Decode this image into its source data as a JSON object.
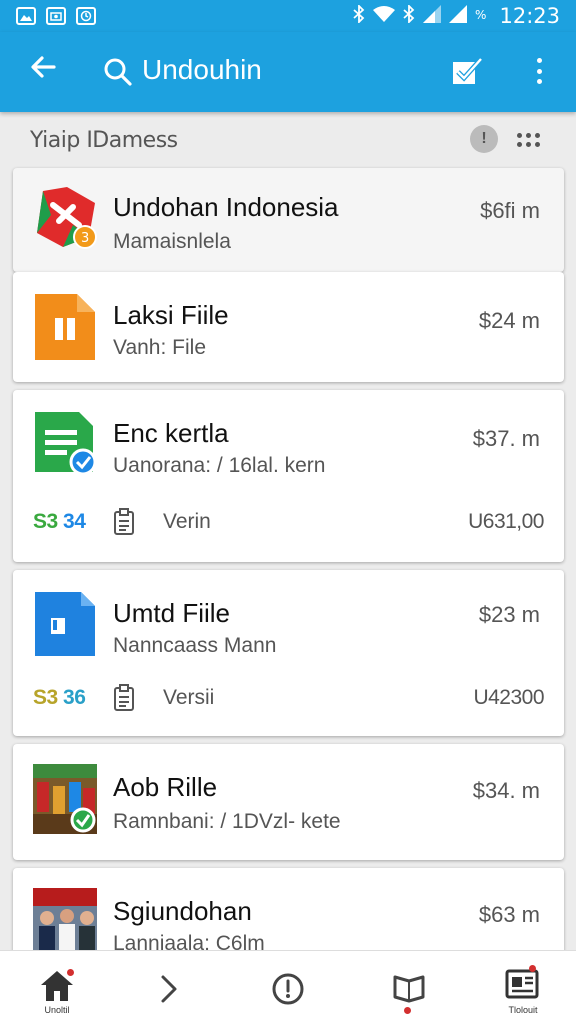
{
  "status_bar": {
    "time": "12:23",
    "left_icons": [
      "gallery-notification-icon",
      "photo-notification-icon",
      "sync-notification-icon"
    ],
    "right_icons": [
      "bluetooth-icon",
      "wifi-icon",
      "bluetooth-icon",
      "signal-icon",
      "signal-icon",
      "battery-percent-icon"
    ]
  },
  "app_bar": {
    "title": "Undouhin",
    "icons": [
      "back-arrow-icon",
      "search-icon",
      "select-all-icon",
      "more-vert-icon"
    ]
  },
  "section": {
    "title": "Yiaip IDamess",
    "icons": [
      "info-icon",
      "grid-dots-icon"
    ]
  },
  "items": [
    {
      "title": "Undohan Indonesia",
      "subtitle": "Mamaisnlela",
      "size": "$6fi m",
      "icon": "red-app-icon"
    },
    {
      "title": "Laksi Fiile",
      "subtitle": "Vanh: File",
      "size": "$24 m",
      "icon": "orange-file-icon"
    },
    {
      "title": "Enc kertla",
      "subtitle": "Uanorana: / 16lal. kern",
      "size": "$37. m",
      "icon": "green-doc-icon",
      "meta": {
        "count_a": "S3",
        "count_b": "34",
        "label": "Verin",
        "value": "U631,00"
      }
    },
    {
      "title": "Umtd  Fiile",
      "subtitle": "Nanncaass Mann",
      "size": "$23 m",
      "icon": "blue-file-icon",
      "meta": {
        "count_a": "S3",
        "count_b": "36",
        "label": "Versii",
        "value": "U42300"
      }
    },
    {
      "title": "Aob Rille",
      "subtitle": "Ramnbani: /  1DVzl- kete",
      "size": "$34. m",
      "icon": "photo-thumbnail-icon"
    },
    {
      "title": "Sgiundohan",
      "subtitle": "Lanniaala: C6lm",
      "size": "$63 m",
      "icon": "people-photo-thumbnail-icon"
    }
  ],
  "bottom_nav": [
    {
      "label": "Unoltil",
      "icon": "home-icon"
    },
    {
      "label": "",
      "icon": "chevron-right-icon"
    },
    {
      "label": "",
      "icon": "alert-circle-icon"
    },
    {
      "label": "",
      "icon": "book-icon"
    },
    {
      "label": "Tlolouit",
      "icon": "news-icon"
    }
  ],
  "colors": {
    "primary": "#1da1df",
    "accent_green": "#3aa93f",
    "accent_blue": "#1e88e5",
    "badge_red": "#d32f2f"
  }
}
